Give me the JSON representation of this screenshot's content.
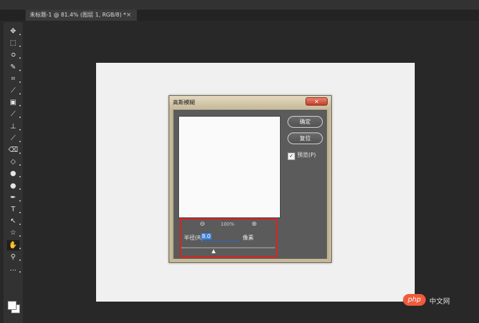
{
  "document_tab": {
    "label": "未标题-1 @ 81.4% (图层 1, RGB/8) *",
    "close_glyph": "×"
  },
  "tools": [
    {
      "icon": "move-icon",
      "glyph": "✥"
    },
    {
      "icon": "marquee-icon",
      "glyph": "⬚"
    },
    {
      "icon": "lasso-icon",
      "glyph": "ഠ"
    },
    {
      "icon": "quick-select-icon",
      "glyph": "✎"
    },
    {
      "icon": "crop-icon",
      "glyph": "⌗"
    },
    {
      "icon": "eyedropper-icon",
      "glyph": "⟋"
    },
    {
      "icon": "healing-icon",
      "glyph": "▣"
    },
    {
      "icon": "brush-icon",
      "glyph": "⟋"
    },
    {
      "icon": "stamp-icon",
      "glyph": "⊥"
    },
    {
      "icon": "history-brush-icon",
      "glyph": "⟋"
    },
    {
      "icon": "eraser-icon",
      "glyph": "⌫"
    },
    {
      "icon": "bucket-icon",
      "glyph": "◇"
    },
    {
      "icon": "blur-icon",
      "glyph": "●"
    },
    {
      "icon": "dodge-icon",
      "glyph": "●"
    },
    {
      "icon": "pen-icon",
      "glyph": "✒"
    },
    {
      "icon": "type-icon",
      "glyph": "T"
    },
    {
      "icon": "path-select-icon",
      "glyph": "↖"
    },
    {
      "icon": "shape-icon",
      "glyph": "☆"
    },
    {
      "icon": "hand-icon",
      "glyph": "✋",
      "selected": true
    },
    {
      "icon": "zoom-icon",
      "glyph": "⚲"
    },
    {
      "icon": "more-icon",
      "glyph": "…"
    }
  ],
  "dialog": {
    "title": "高斯模糊",
    "close_glyph": "✕",
    "ok_label": "确定",
    "reset_label": "复位",
    "preview_checked": true,
    "preview_label": "预览(P)",
    "zoom_level": "100%",
    "zoom_out_glyph": "⊖",
    "zoom_in_glyph": "⊕",
    "radius_label": "半径(R):",
    "radius_value": "8.0",
    "radius_unit": "像素",
    "checkmark": "✓"
  },
  "watermark": {
    "logo": "php",
    "text": "中文网"
  },
  "colors": {
    "highlight": "#e02020",
    "accent": "#3b82e0"
  }
}
